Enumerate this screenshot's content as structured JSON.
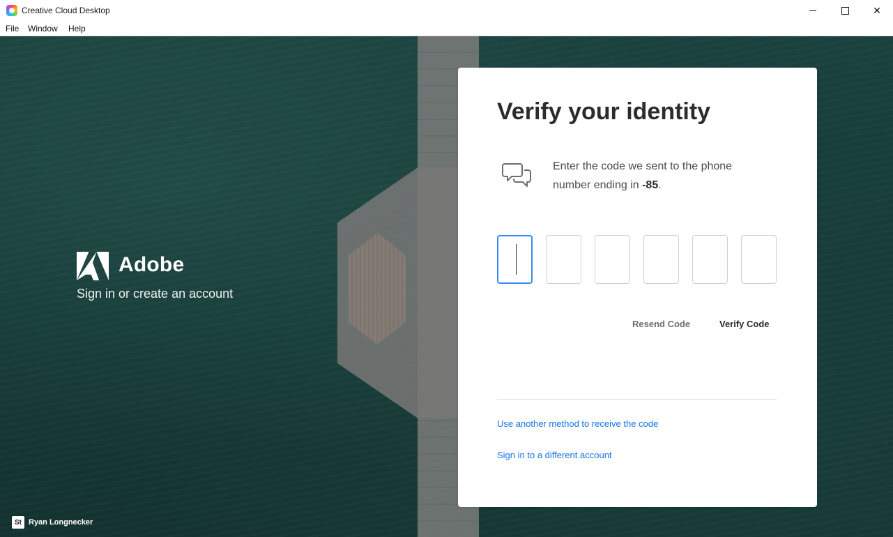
{
  "window": {
    "title": "Creative Cloud Desktop",
    "controls": {
      "minimize": "minimize",
      "maximize": "maximize",
      "close": "✕"
    }
  },
  "menu": [
    "File",
    "Window",
    "Help"
  ],
  "brand": {
    "name": "Adobe",
    "tagline": "Sign in or create an account"
  },
  "photo_credit": {
    "badge": "St",
    "name": "Ryan Longnecker"
  },
  "card": {
    "title": "Verify your identity",
    "instruction_prefix": "Enter the code we sent to the phone number ending in ",
    "phone_suffix": "-85",
    "instruction_end": ".",
    "code_inputs": [
      "",
      "",
      "",
      "",
      "",
      ""
    ],
    "resend_label": "Resend Code",
    "verify_label": "Verify Code",
    "alt_method_link": "Use another method to receive the code",
    "different_account_link": "Sign in to a different account"
  },
  "icons": {
    "app": "creative-cloud-icon",
    "message": "chat-bubbles-icon",
    "logo": "adobe-logo"
  },
  "colors": {
    "accent": "#1473e6",
    "focus": "#378ef0",
    "background": "#1f4c47"
  }
}
